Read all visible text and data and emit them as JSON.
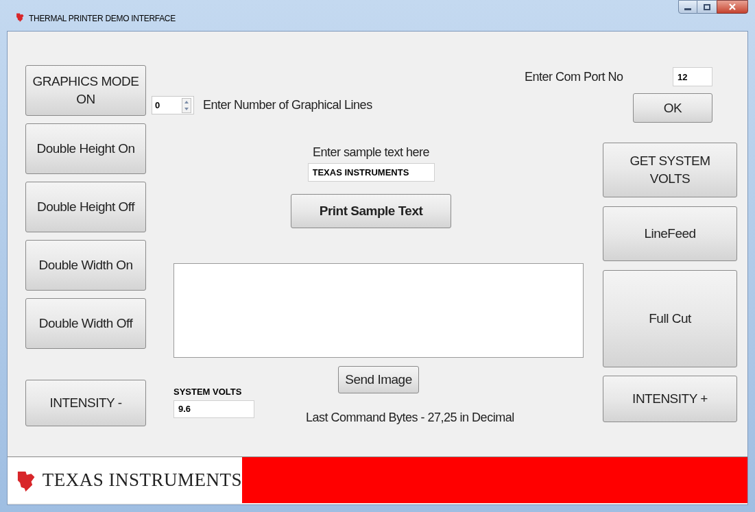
{
  "window": {
    "title": "THERMAL PRINTER DEMO INTERFACE"
  },
  "left_buttons": [
    "GRAPHICS MODE\nON",
    "Double Height On",
    "Double Height Off",
    "Double Width On",
    "Double Width Off"
  ],
  "intensity_minus": "INTENSITY -",
  "graphical_lines": {
    "value": "0",
    "label": "Enter Number of Graphical Lines"
  },
  "sample_text": {
    "label": "Enter sample text here",
    "value": "TEXAS INSTRUMENTS",
    "button": "Print Sample Text"
  },
  "send_image": "Send Image",
  "system_volts": {
    "label": "SYSTEM VOLTS",
    "value": "9.6"
  },
  "last_command": "Last Command Bytes - 27,25 in Decimal",
  "com_port": {
    "label": "Enter Com Port No",
    "value": "12",
    "button": "OK"
  },
  "right_buttons": [
    "GET SYSTEM\nVOLTS",
    "LineFeed",
    "Full Cut"
  ],
  "intensity_plus": "INTENSITY +",
  "footer": {
    "brand": "TEXAS INSTRUMENTS"
  }
}
